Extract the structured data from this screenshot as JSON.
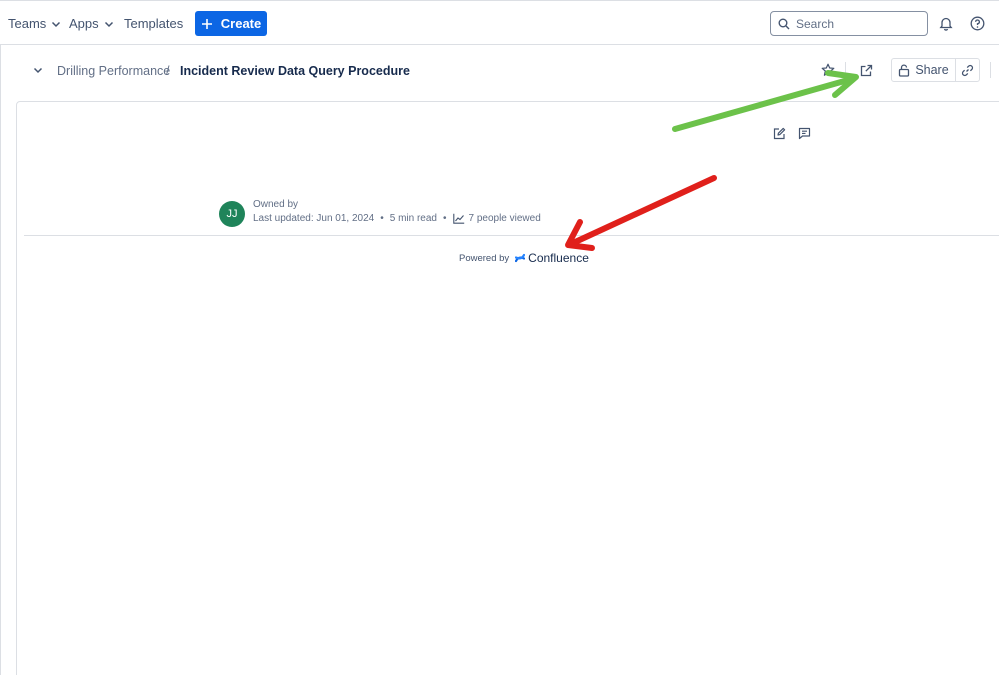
{
  "topnav": {
    "teams_label": "Teams",
    "apps_label": "Apps",
    "templates_label": "Templates",
    "create_label": "Create",
    "search": {
      "placeholder": "Search",
      "value": ""
    },
    "icons": [
      "chevron-down-icon",
      "plus-icon",
      "search-icon",
      "bell-icon",
      "help-icon"
    ]
  },
  "breadcrumb": {
    "parent": "Drilling Performance",
    "separator": "/",
    "title": "Incident Review Data Query Procedure"
  },
  "page_actions": {
    "share_label": "Share",
    "icons": [
      "star-icon",
      "open-external-icon",
      "lock-icon",
      "link-icon"
    ]
  },
  "content": {
    "owner": {
      "initials": "JJ",
      "owned_by_label": "Owned by"
    },
    "last_updated": "Last updated: Jun 01, 2024",
    "read_time": "5 min read",
    "viewers": "7 people viewed",
    "separator": "•",
    "icons": [
      "edit-icon",
      "comment-icon",
      "analytics-icon"
    ]
  },
  "footer": {
    "powered_by_label": "Powered by",
    "brand": "Confluence"
  },
  "annotations": {
    "green_arrow_color": "#6cc24a",
    "red_arrow_color": "#e0201b"
  },
  "colors": {
    "primary": "#0c66e4",
    "avatar_bg": "#1f845a",
    "border": "#dcdfe4"
  }
}
